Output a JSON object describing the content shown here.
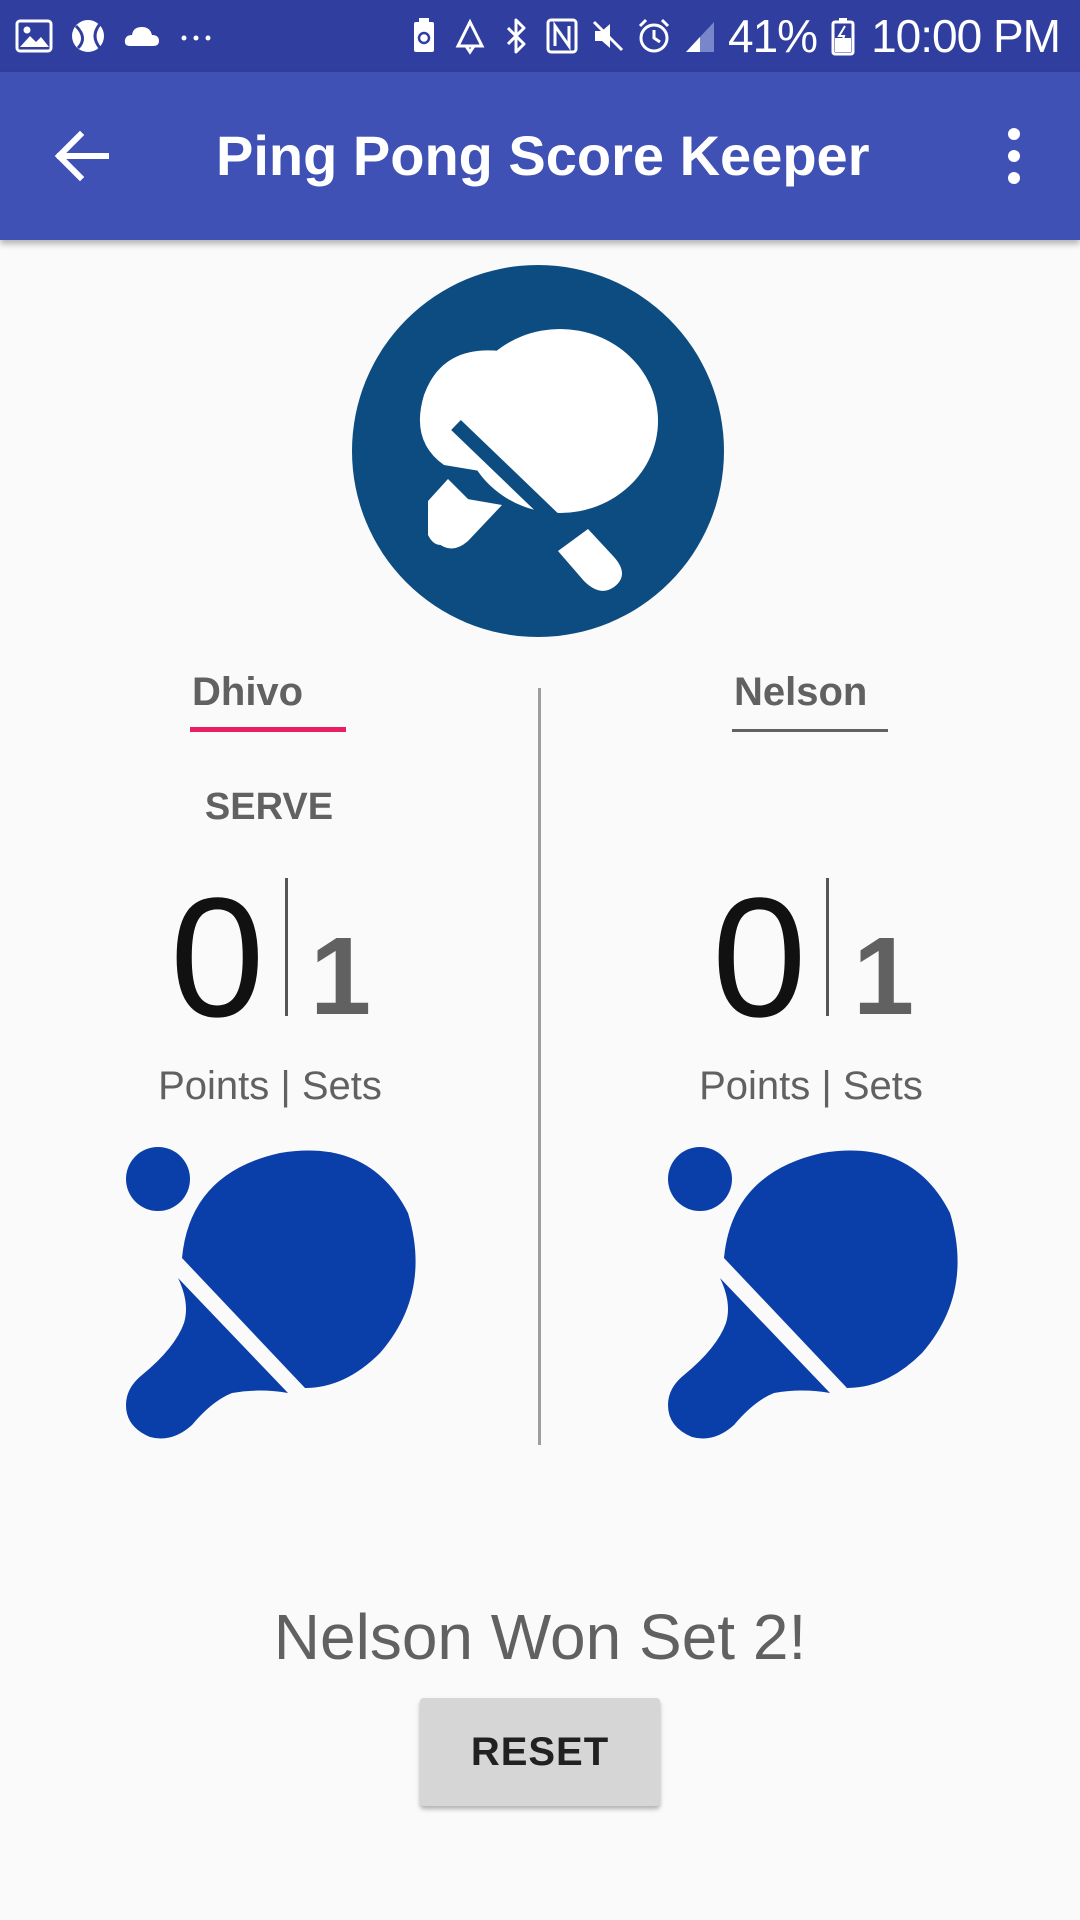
{
  "status_bar": {
    "battery_percent": "41%",
    "time": "10:00 PM",
    "left_icons": [
      "image-icon",
      "ball-icon",
      "cloud-icon",
      "more-dots-icon"
    ],
    "right_icons": [
      "battery-saver-icon",
      "recycle-icon",
      "bluetooth-icon",
      "nfc-icon",
      "mute-icon",
      "alarm-icon",
      "signal-icon",
      "battery-icon"
    ]
  },
  "app_bar": {
    "title": "Ping Pong Score Keeper",
    "back_icon": "arrow-back-icon",
    "overflow_icon": "more-vert-icon",
    "color": "#3f51b5",
    "status_color": "#303f9f"
  },
  "logo": {
    "icon": "ping-pong-paddles-logo",
    "color": "#0d4c80"
  },
  "players": [
    {
      "name": "Dhivo",
      "serve_label": "SERVE",
      "points": "0",
      "sets": "1",
      "caption": "Points | Sets",
      "focused": true,
      "paddle_icon": "paddle-icon"
    },
    {
      "name": "Nelson",
      "serve_label": "",
      "points": "0",
      "sets": "1",
      "caption": "Points | Sets",
      "focused": false,
      "paddle_icon": "paddle-icon"
    }
  ],
  "colors": {
    "focus_underline": "#e91e63",
    "paddle_blue": "#0a3ea8"
  },
  "status_message": "Nelson Won Set 2!",
  "reset_label": "RESET"
}
